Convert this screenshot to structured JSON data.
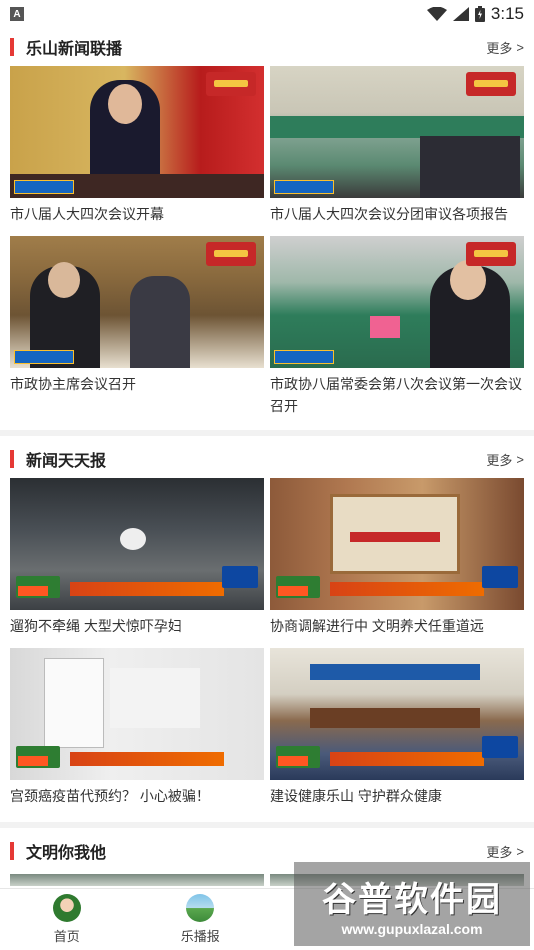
{
  "status_bar": {
    "time": "3:15",
    "left_icon": "A"
  },
  "sections": [
    {
      "title": "乐山新闻联播",
      "more": "更多",
      "items": [
        {
          "caption": "市八届人大四次会议开幕"
        },
        {
          "caption": "市八届人大四次会议分团审议各项报告"
        },
        {
          "caption": "市政协主席会议召开"
        },
        {
          "caption": "市政协八届常委会第八次会议第一次会议召开"
        }
      ]
    },
    {
      "title": "新闻天天报",
      "more": "更多",
      "items": [
        {
          "caption": "遛狗不牵绳 大型犬惊吓孕妇"
        },
        {
          "caption": "协商调解进行中 文明养犬任重道远"
        },
        {
          "caption": "宫颈癌疫苗代预约？ 小心被骗！"
        },
        {
          "caption": "建设健康乐山 守护群众健康"
        }
      ]
    },
    {
      "title": "文明你我他",
      "more": "更多"
    }
  ],
  "tabbar": [
    {
      "label": "首页",
      "icon": "home-avatar-icon"
    },
    {
      "label": "乐播报",
      "icon": "broadcast-icon"
    }
  ],
  "watermark": {
    "title": "谷普软件园",
    "url": "www.gupuxlazal.com"
  },
  "colors": {
    "accent": "#e53935",
    "divider": "#f2f2f2"
  }
}
